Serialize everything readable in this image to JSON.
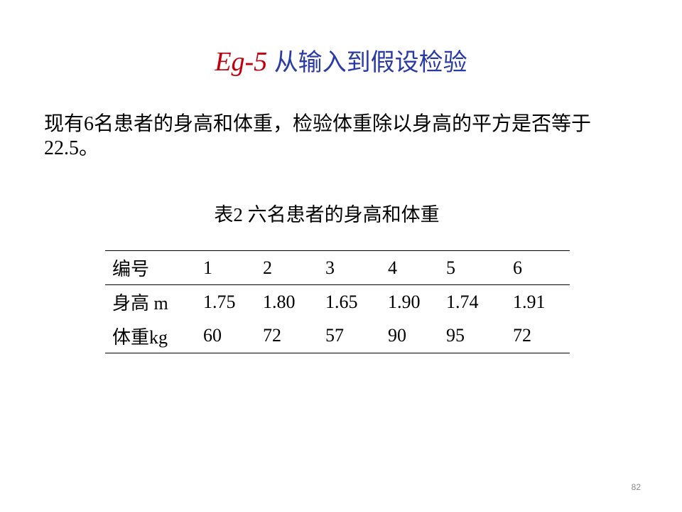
{
  "slide": {
    "title_prefix": "Eg-5",
    "title_main": "从输入到假设检验",
    "problem_text": "现有6名患者的身高和体重，检验体重除以身高的平方是否等于22.5。",
    "page_number": "82"
  },
  "table": {
    "caption": "表2 六名患者的身高和体重",
    "header": [
      "编号",
      "1",
      "2",
      "3",
      "4",
      "5",
      "6"
    ],
    "rows": [
      [
        "身高 m",
        "1.75",
        "1.80",
        "1.65",
        "1.90",
        "1.74",
        "1.91"
      ],
      [
        "体重kg",
        "60",
        "72",
        "57",
        "90",
        "95",
        "72"
      ]
    ]
  }
}
